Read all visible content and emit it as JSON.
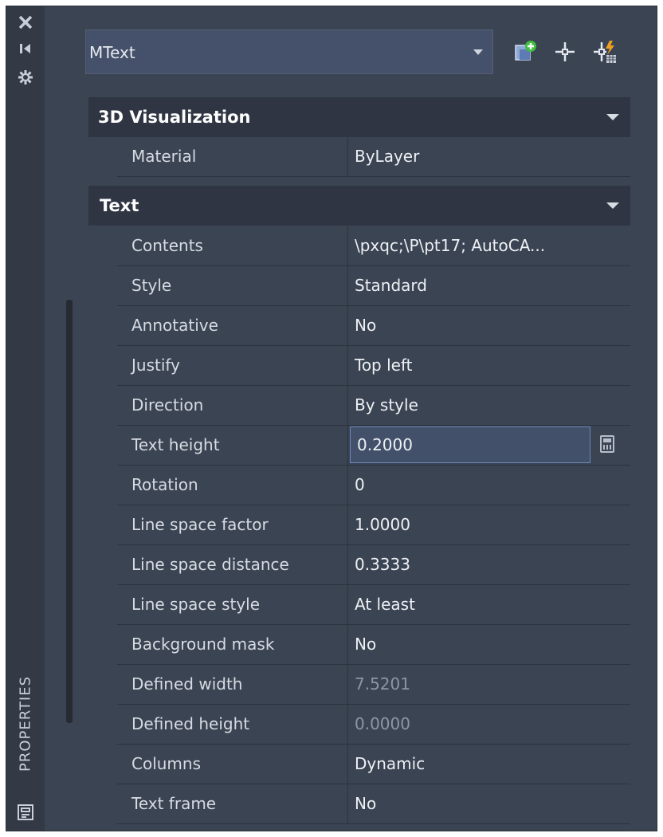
{
  "panel": {
    "vertical_title": "PROPERTIES"
  },
  "strip_icons": [
    "close-icon",
    "autohide-icon",
    "settings-icon",
    "properties-panel-icon"
  ],
  "object_selector": {
    "value": "MText"
  },
  "toolbar_icons": [
    "toggle-pickadd-icon",
    "select-objects-icon",
    "quick-select-icon"
  ],
  "sections": {
    "visualization": {
      "title": "3D Visualization",
      "rows": [
        {
          "label": "Material",
          "value": "ByLayer"
        }
      ]
    },
    "text": {
      "title": "Text",
      "rows": [
        {
          "label": "Contents",
          "value": "\\pxqc;\\P\\pt17;  AutoCA..."
        },
        {
          "label": "Style",
          "value": "Standard"
        },
        {
          "label": "Annotative",
          "value": "No"
        },
        {
          "label": "Justify",
          "value": "Top left"
        },
        {
          "label": "Direction",
          "value": "By style"
        },
        {
          "label": "Text height",
          "value": "0.2000"
        },
        {
          "label": "Rotation",
          "value": "0"
        },
        {
          "label": "Line space factor",
          "value": "1.0000"
        },
        {
          "label": "Line space distance",
          "value": "0.3333"
        },
        {
          "label": "Line space style",
          "value": "At least"
        },
        {
          "label": "Background mask",
          "value": "No"
        },
        {
          "label": "Defined width",
          "value": "7.5201"
        },
        {
          "label": "Defined height",
          "value": "0.0000"
        },
        {
          "label": "Columns",
          "value": "Dynamic"
        },
        {
          "label": "Text frame",
          "value": "No"
        }
      ]
    }
  },
  "colors": {
    "panel_bg": "#3b4453",
    "section_header_bg": "#2f3542",
    "edit_field_border": "#6d88b8",
    "disabled_text": "#8e96a4"
  }
}
